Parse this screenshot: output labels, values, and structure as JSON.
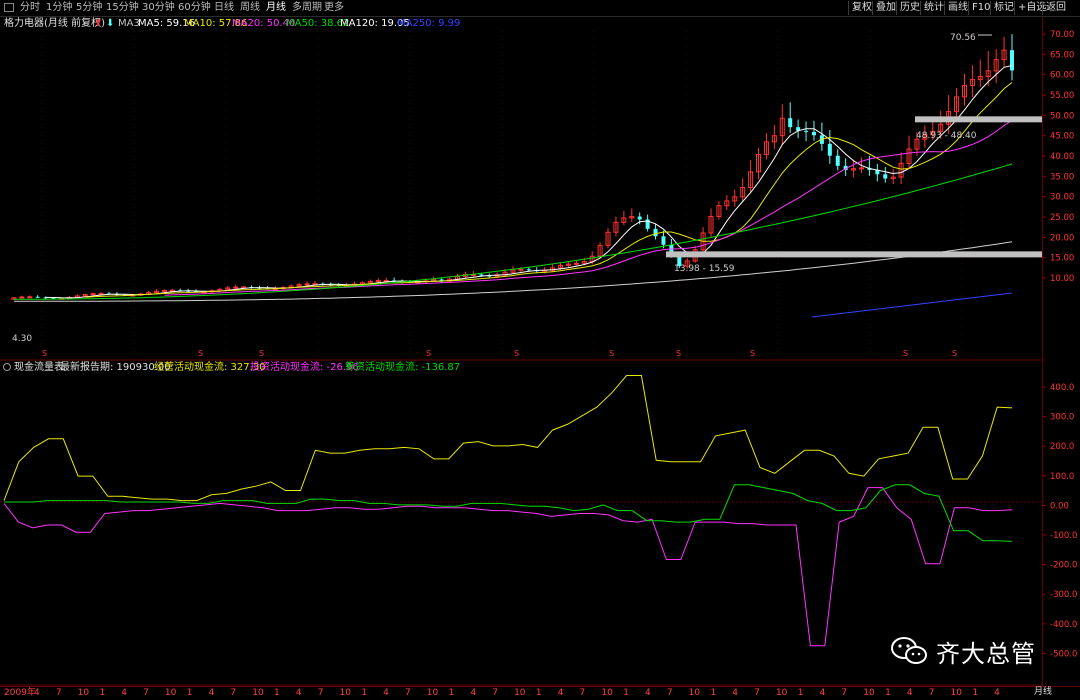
{
  "toolbar": {
    "tabs": [
      {
        "label": "分时",
        "active": false
      },
      {
        "label": "1分钟",
        "active": false
      },
      {
        "label": "5分钟",
        "active": false
      },
      {
        "label": "15分钟",
        "active": false
      },
      {
        "label": "30分钟",
        "active": false
      },
      {
        "label": "60分钟",
        "active": false
      },
      {
        "label": "日线",
        "active": false
      },
      {
        "label": "周线",
        "active": false
      },
      {
        "label": "月线",
        "active": true
      },
      {
        "label": "多周期",
        "active": false
      },
      {
        "label": "更多",
        "active": false
      }
    ],
    "right_buttons": [
      "复权",
      "叠加",
      "历史",
      "统计",
      "画线",
      "F10",
      "标记",
      "+自选",
      "返回"
    ]
  },
  "main_panel": {
    "title": "格力电器(月线 前复权)",
    "ma_labels": [
      {
        "text": "MA3",
        "color": "#c8c8c8"
      },
      {
        "text": "MA5: 59.16",
        "color": "#ffffff"
      },
      {
        "text": "MA10: 57.86",
        "color": "#e8e800"
      },
      {
        "text": "MA20: 50.40",
        "color": "#ff33ff"
      },
      {
        "text": "MA50: 38.62",
        "color": "#00dd00"
      },
      {
        "text": "MA120: 19.05",
        "color": "#ffffff"
      },
      {
        "text": "MA250: 9.99",
        "color": "#3344ff"
      }
    ],
    "annotations": {
      "high_label": "70.56",
      "low_label": "4.30",
      "zone_upper_label": "48.93 - 48.40",
      "zone_lower_label": "13.98 - 15.59"
    }
  },
  "cashflow_panel": {
    "title": "现金流量表",
    "report_period": "最新报告期: 190930.00",
    "series_labels": [
      {
        "text": "经营活动现金流: 327.30",
        "color": "#e8e800"
      },
      {
        "text": "投资活动现金流: -26.96",
        "color": "#ff33ff"
      },
      {
        "text": "筹资活动现金流: -136.87",
        "color": "#00dd00"
      }
    ]
  },
  "price_axis": {
    "ticks": [
      "70.00",
      "65.00",
      "60.00",
      "55.00",
      "50.00",
      "45.00",
      "40.00",
      "35.00",
      "30.00",
      "25.00",
      "20.00",
      "15.00",
      "10.00"
    ]
  },
  "cashflow_axis": {
    "ticks": [
      "400.0",
      "300.0",
      "200.0",
      "100.0",
      "0.00",
      "-100.0",
      "-200.0",
      "-300.0",
      "-400.0",
      "-500.0"
    ]
  },
  "time_axis": {
    "labels": [
      "2009年",
      "4",
      "7",
      "10",
      "1",
      "4",
      "7",
      "10",
      "1",
      "4",
      "7",
      "10",
      "1",
      "4",
      "7",
      "10",
      "1",
      "4",
      "7",
      "10",
      "1",
      "4",
      "7",
      "10",
      "1",
      "4",
      "7",
      "10",
      "1",
      "4",
      "7",
      "10",
      "1",
      "4",
      "7",
      "10",
      "1",
      "4",
      "7",
      "10",
      "1",
      "4",
      "7",
      "10",
      "1",
      "4"
    ],
    "bottom_tab": "月线"
  },
  "watermark": {
    "text": "齐大总管"
  },
  "colors": {
    "background": "#000000",
    "up_candle": "#ff3232",
    "down_candle": "#54ffff",
    "zone_band": "#c0c0c0",
    "grid": "#5a0000"
  },
  "chart_data": [
    {
      "type": "line",
      "title": "格力电器(月线 前复权)",
      "series": [
        {
          "name": "MA5",
          "last_value": 59.16
        },
        {
          "name": "MA10",
          "last_value": 57.86
        },
        {
          "name": "MA20",
          "last_value": 50.4
        },
        {
          "name": "MA50",
          "last_value": 38.62
        },
        {
          "name": "MA120",
          "last_value": 19.05
        },
        {
          "name": "MA250",
          "last_value": 9.99
        }
      ],
      "ylim": [
        4,
        72
      ],
      "annotations": {
        "high": 70.56,
        "low": 4.3,
        "zones": [
          [
            48.4,
            48.93
          ],
          [
            13.98,
            15.59
          ]
        ]
      }
    },
    {
      "type": "line",
      "title": "现金流量表",
      "series": [
        {
          "name": "经营活动现金流",
          "values": [
            5,
            140,
            190,
            220,
            220,
            90,
            90,
            20,
            20,
            15,
            10,
            10,
            5,
            5,
            25,
            30,
            45,
            55,
            70,
            40,
            40,
            180,
            170,
            170,
            180,
            185,
            185,
            190,
            185,
            150,
            150,
            205,
            210,
            195,
            195,
            200,
            190,
            250,
            270,
            300,
            330,
            380,
            440,
            440,
            145,
            140,
            140,
            140,
            230,
            240,
            250,
            120,
            100,
            140,
            180,
            180,
            160,
            100,
            90,
            150,
            160,
            170,
            260,
            260,
            80,
            80,
            160,
            330,
            327.3
          ]
        },
        {
          "name": "投资活动现金流",
          "values": [
            -5,
            -70,
            -90,
            -80,
            -80,
            -105,
            -105,
            -40,
            -35,
            -30,
            -30,
            -25,
            -20,
            -15,
            -10,
            -5,
            -10,
            -15,
            -20,
            -30,
            -30,
            -30,
            -25,
            -20,
            -20,
            -25,
            -25,
            -20,
            -15,
            -15,
            -20,
            -20,
            -20,
            -25,
            -30,
            -30,
            -35,
            -40,
            -50,
            -45,
            -40,
            -40,
            -45,
            -65,
            -70,
            -60,
            -200,
            -200,
            -70,
            -70,
            -70,
            -75,
            -75,
            -80,
            -80,
            -80,
            -500,
            -500,
            -70,
            -50,
            50,
            50,
            -20,
            -60,
            -215,
            -215,
            -20,
            -20,
            -30,
            -30,
            -26.96
          ]
        },
        {
          "name": "筹资活动现金流",
          "values": [
            0,
            0,
            0,
            5,
            5,
            5,
            5,
            5,
            0,
            0,
            0,
            0,
            0,
            -5,
            -5,
            5,
            5,
            5,
            -5,
            -5,
            -5,
            10,
            10,
            5,
            5,
            -5,
            -5,
            -10,
            -10,
            -10,
            -15,
            -15,
            -5,
            -5,
            -5,
            -10,
            -15,
            -15,
            -20,
            -30,
            -25,
            -10,
            -30,
            -30,
            -65,
            -65,
            -70,
            -70,
            -60,
            -60,
            60,
            60,
            50,
            40,
            30,
            5,
            -5,
            -30,
            -30,
            -20,
            40,
            60,
            60,
            30,
            20,
            -100,
            -100,
            -135,
            -135,
            -136.87
          ]
        }
      ],
      "ylim": [
        -500,
        480
      ]
    }
  ]
}
